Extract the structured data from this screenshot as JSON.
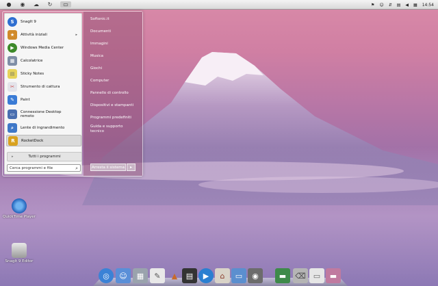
{
  "menubar": {
    "icons": [
      "apple-icon",
      "globe-icon",
      "cloud-icon",
      "refresh-icon",
      "window-icon"
    ],
    "tray_icons": [
      "flag-icon",
      "user-icon",
      "arrows-icon",
      "network-icon",
      "volume-icon",
      "calendar-icon"
    ],
    "time": "14:54"
  },
  "start_menu": {
    "programs": [
      {
        "label": "SnagIt 9",
        "icon": "snagit-icon",
        "color": "#2f6fd1"
      },
      {
        "label": "Attività iniziali",
        "icon": "start-icon",
        "color": "#d08a2a",
        "submenu": true
      },
      {
        "label": "Windows Media Center",
        "icon": "media-center-icon",
        "color": "#3d8a2a"
      },
      {
        "label": "Calcolatrice",
        "icon": "calculator-icon",
        "color": "#7f8ea6"
      },
      {
        "label": "Sticky Notes",
        "icon": "sticky-notes-icon",
        "color": "#e6d35a"
      },
      {
        "label": "Strumento di cattura",
        "icon": "scissors-icon",
        "color": "#c44"
      },
      {
        "label": "Paint",
        "icon": "paint-icon",
        "color": "#3a7bd5"
      },
      {
        "label": "Connessione Desktop remoto",
        "icon": "remote-desktop-icon",
        "color": "#4a6fb0"
      },
      {
        "label": "Lente di ingrandimento",
        "icon": "magnifier-icon",
        "color": "#3f78c8"
      },
      {
        "label": "RocketDock",
        "icon": "rocketdock-icon",
        "color": "#d9a21f",
        "selected": true
      }
    ],
    "all_programs": "Tutti i programmi",
    "search_placeholder": "Cerca programmi e file",
    "right_links": [
      "Softonic.it",
      "Documenti",
      "Immagini",
      "Musica",
      "Giochi",
      "Computer",
      "Pannello di controllo",
      "Dispositivi e stampanti",
      "Programmi predefiniti",
      "Guida e supporto tecnico"
    ],
    "shutdown": "Arresta il sistema"
  },
  "desktop_icons": [
    {
      "label": "QuickTime Player",
      "icon": "quicktime-icon"
    },
    {
      "label": "SnagIt 9 Editor",
      "icon": "snagit-editor-icon"
    }
  ],
  "dock_items": [
    {
      "name": "safari-icon",
      "color": "#3b82d6",
      "glyph": "◎"
    },
    {
      "name": "finder-icon",
      "color": "#5a8fd8",
      "glyph": "☺"
    },
    {
      "name": "calculator-icon",
      "color": "#9aa3ad",
      "glyph": "▦"
    },
    {
      "name": "notes-icon",
      "color": "#e8e8e8",
      "glyph": "✎"
    },
    {
      "name": "pyramid-icon",
      "color": "#c86a2a",
      "glyph": "▲"
    },
    {
      "name": "film-icon",
      "color": "#333",
      "glyph": "▤"
    },
    {
      "name": "play-icon",
      "color": "#2a7fd1",
      "glyph": "▶"
    },
    {
      "name": "home-icon",
      "color": "#d9d3c8",
      "glyph": "⌂"
    },
    {
      "name": "monitor-icon",
      "color": "#5b8fcf",
      "glyph": "▭"
    },
    {
      "name": "photo-booth-icon",
      "color": "#6c6c6c",
      "glyph": "◉"
    },
    {
      "name": "separator",
      "color": "transparent",
      "glyph": ""
    },
    {
      "name": "landscape-icon",
      "color": "#3e8a4a",
      "glyph": "▬"
    },
    {
      "name": "trash-icon",
      "color": "#b5b5b5",
      "glyph": "⌫"
    },
    {
      "name": "drive-icon",
      "color": "#e6e6e6",
      "glyph": "▭"
    },
    {
      "name": "wallpaper-icon",
      "color": "#c07aa0",
      "glyph": "▬"
    }
  ]
}
